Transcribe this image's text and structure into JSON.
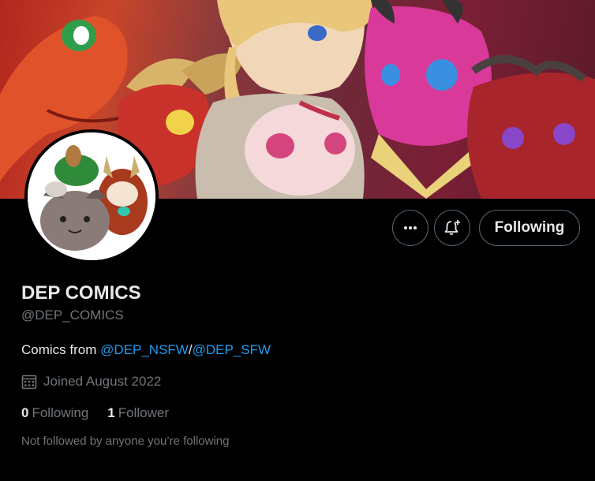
{
  "profile": {
    "display_name": "DEP COMICS",
    "handle": "@DEP_COMICS",
    "bio": {
      "prefix": "Comics from ",
      "mention1": "@DEP_NSFW",
      "separator": "/",
      "mention2": "@DEP_SFW"
    },
    "joined": "Joined August 2022",
    "following_count": "0",
    "following_label": "Following",
    "followers_count": "1",
    "followers_label": "Follower",
    "followed_by_note": "Not followed by anyone you’re following"
  },
  "actions": {
    "more_icon": "more-dots-icon",
    "notify_icon": "bell-plus-icon",
    "follow_label": "Following"
  },
  "colors": {
    "background": "#000000",
    "text_primary": "#e7e9ea",
    "text_secondary": "#71767b",
    "link": "#1d9bf0",
    "button_border": "#536471"
  }
}
